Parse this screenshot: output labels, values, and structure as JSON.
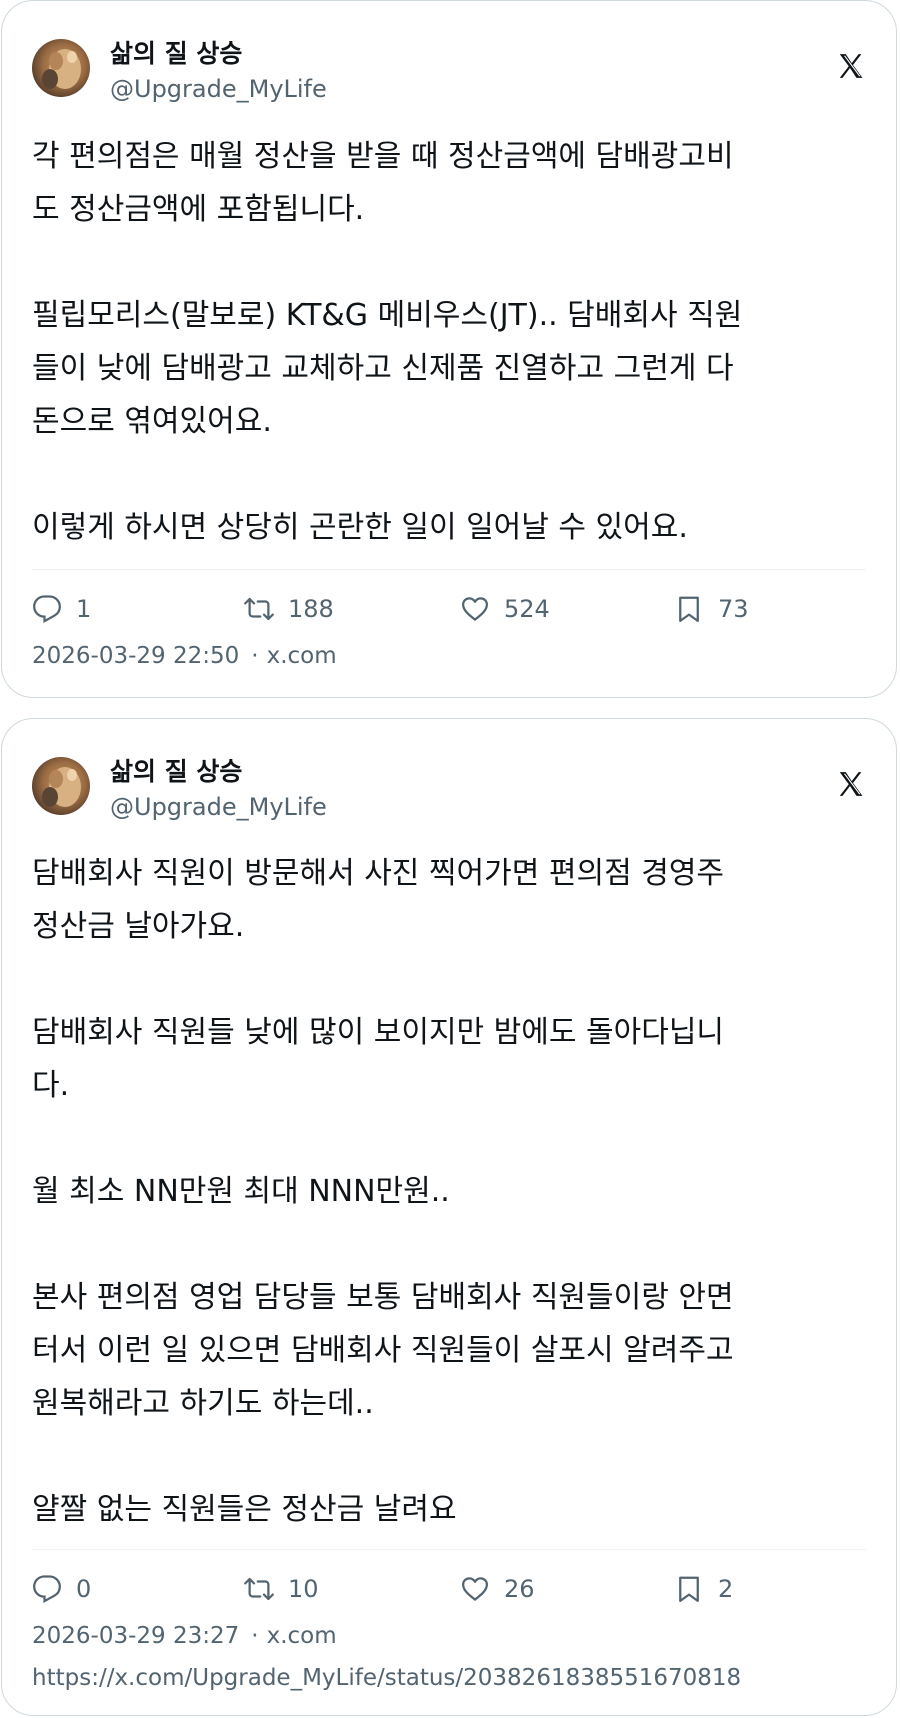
{
  "tweets": [
    {
      "author": {
        "name": "삶의 질 상승",
        "handle": "@Upgrade_MyLife"
      },
      "text": "각 편의점은 매월 정산을 받을 때 정산금액에 담배광고비\n도 정산금액에 포함됩니다.\n\n필립모리스(말보로) KT&G 메비우스(JT).. 담배회사 직원\n들이 낮에 담배광고 교체하고 신제품 진열하고 그런게 다\n돈으로 엮여있어요.\n\n이렇게 하시면 상당히 곤란한 일이 일어날 수 있어요.",
      "stats": {
        "replies": "1",
        "retweets": "188",
        "likes": "524",
        "bookmarks": "73"
      },
      "timestamp": "2026-03-29 22:50",
      "source": "x.com"
    },
    {
      "author": {
        "name": "삶의 질 상승",
        "handle": "@Upgrade_MyLife"
      },
      "text": "담배회사 직원이 방문해서 사진 찍어가면 편의점 경영주\n정산금 날아가요.\n\n담배회사 직원들 낮에 많이 보이지만 밤에도 돌아다닙니\n다.\n\n월 최소 NN만원 최대 NNN만원..\n\n본사 편의점 영업 담당들 보통 담배회사 직원들이랑 안면\n터서 이런 일 있으면 담배회사 직원들이 살포시 알려주고\n원복해라고 하기도 하는데..\n\n얄짤 없는 직원들은 정산금 날려요",
      "stats": {
        "replies": "0",
        "retweets": "10",
        "likes": "26",
        "bookmarks": "2"
      },
      "timestamp": "2026-03-29 23:27",
      "source": "x.com",
      "url": "https://x.com/Upgrade_MyLife/status/2038261838551670818"
    }
  ],
  "icons": {
    "platform_logo": "x-logo-icon",
    "reply": "reply-icon",
    "retweet": "retweet-icon",
    "like": "heart-icon",
    "bookmark": "bookmark-icon"
  },
  "colors": {
    "text": "#0f1419",
    "secondary": "#536471",
    "border": "#cfd9de"
  }
}
